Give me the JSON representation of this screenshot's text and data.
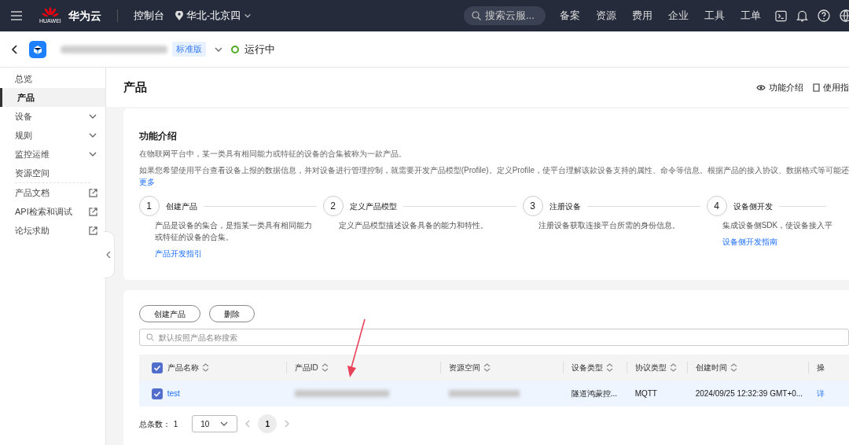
{
  "topbar": {
    "logo_text": "HUAWEI",
    "brand": "华为云",
    "console": "控制台",
    "region": "华北-北京四",
    "search_placeholder": "搜索云服...",
    "menu": [
      "备案",
      "资源",
      "费用",
      "企业",
      "工具",
      "工单"
    ]
  },
  "header": {
    "edition_badge": "标准版",
    "status": "运行中"
  },
  "sidebar": {
    "items": [
      {
        "label": "总览",
        "kind": "plain",
        "selected": false
      },
      {
        "label": "产品",
        "kind": "plain",
        "selected": true
      },
      {
        "label": "设备",
        "kind": "expandable",
        "selected": false
      },
      {
        "label": "规则",
        "kind": "expandable",
        "selected": false
      },
      {
        "label": "监控运维",
        "kind": "expandable",
        "selected": false
      },
      {
        "label": "资源空间",
        "kind": "plain",
        "selected": false
      },
      {
        "label": "产品文档",
        "kind": "external",
        "selected": false
      },
      {
        "label": "API检索和调试",
        "kind": "external",
        "selected": false
      },
      {
        "label": "论坛求助",
        "kind": "external",
        "selected": false
      }
    ]
  },
  "page": {
    "title": "产品",
    "links": [
      {
        "label": "功能介绍",
        "kind": "eye"
      },
      {
        "label": "使用指",
        "kind": "doc"
      }
    ]
  },
  "intro": {
    "title": "功能介绍",
    "paragraphs": [
      "在物联网平台中，某一类具有相同能力或特征的设备的合集被称为一款产品。",
      "如果您希望使用平台查看设备上报的数据信息，并对设备进行管理控制，就需要开发产品模型(Profile)。定义Profile，使平台理解该款设备支持的属性、命令等信息。根据产品的接入协议、数据格式等可能还"
    ],
    "more": "更多",
    "steps": [
      {
        "number": "1",
        "title": "创建产品",
        "desc": "产品是设备的集合，是指某一类具有相同能力或特征的设备的合集。",
        "link": "产品开发指引"
      },
      {
        "number": "2",
        "title": "定义产品模型",
        "desc": "定义产品模型描述设备具备的能力和特性。"
      },
      {
        "number": "3",
        "title": "注册设备",
        "desc": "注册设备获取连接平台所需的身份信息。"
      },
      {
        "number": "4",
        "title": "设备侧开发",
        "desc": "集成设备侧SDK，使设备接入平",
        "link": "设备侧开发指南"
      }
    ]
  },
  "products": {
    "buttons": [
      "创建产品",
      "删除"
    ],
    "search_placeholder": "默认按照产品名称搜索",
    "header_checked": true,
    "columns": [
      {
        "label": "产品名称"
      },
      {
        "label": "产品ID"
      },
      {
        "label": "资源空间"
      },
      {
        "label": "设备类型"
      },
      {
        "label": "协议类型"
      },
      {
        "label": "创建时间"
      },
      {
        "label": "操"
      }
    ],
    "rows": [
      {
        "checked": true,
        "name": "test",
        "device_type": "隧道鸿蒙控...",
        "protocol": "MQTT",
        "created": "2024/09/25 12:32:39 GMT+0...",
        "action": "详"
      }
    ],
    "pagination": {
      "total_label": "总条数：",
      "total": "1",
      "page_size": "10",
      "pages": [
        {
          "label": "1",
          "selected": true
        }
      ]
    }
  }
}
